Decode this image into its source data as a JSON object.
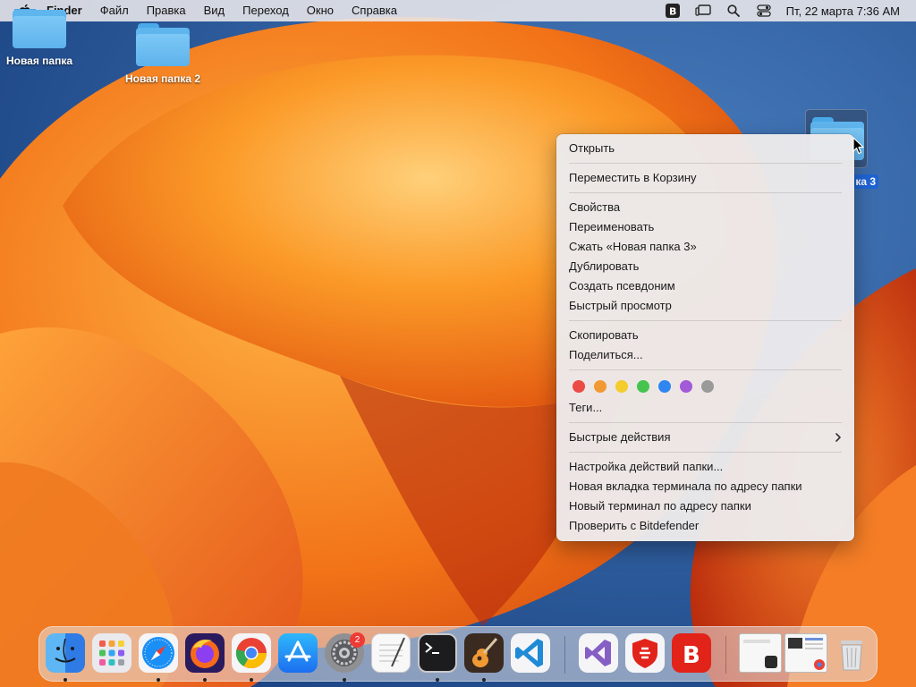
{
  "menubar": {
    "app_name": "Finder",
    "items": [
      "Файл",
      "Правка",
      "Вид",
      "Переход",
      "Окно",
      "Справка"
    ],
    "clock": "Пт, 22 марта  7:36 AM"
  },
  "desktop": {
    "folders": [
      {
        "label": "Новая папка"
      },
      {
        "label": "Новая папка 2"
      },
      {
        "label": "ка 3"
      }
    ]
  },
  "context_menu": {
    "open": "Открыть",
    "trash": "Переместить в Корзину",
    "properties": "Свойства",
    "rename": "Переименовать",
    "compress": "Сжать «Новая папка 3»",
    "duplicate": "Дублировать",
    "alias": "Создать псевдоним",
    "quick_look": "Быстрый просмотр",
    "copy": "Скопировать",
    "share": "Поделиться...",
    "tags": "Теги...",
    "quick_actions": "Быстрые действия",
    "folder_actions": "Настройка действий папки...",
    "new_terminal_tab": "Новая вкладка терминала по адресу папки",
    "new_terminal": "Новый терминал по адресу папки",
    "bitdefender": "Проверить с Bitdefender",
    "tag_colors": [
      "#ec4b45",
      "#f19a34",
      "#f4cd2c",
      "#47c44f",
      "#2f86f0",
      "#a35ad8",
      "#9a9a9a"
    ]
  },
  "dock": {
    "apps": [
      {
        "icon": "finder-icon"
      },
      {
        "icon": "launchpad-icon"
      },
      {
        "icon": "safari-icon"
      },
      {
        "icon": "firefox-icon"
      },
      {
        "icon": "chrome-icon"
      },
      {
        "icon": "app-store-icon"
      },
      {
        "icon": "system-settings-icon"
      },
      {
        "icon": "textedit-icon"
      },
      {
        "icon": "terminal-icon"
      },
      {
        "icon": "garageband-icon"
      },
      {
        "icon": "vscode-icon"
      },
      {
        "icon": "visual-studio-icon"
      },
      {
        "icon": "bitdefender-shield-icon"
      },
      {
        "icon": "bitdefender-icon"
      },
      {
        "icon": "minimized-window-icon"
      },
      {
        "icon": "minimized-chrome-window-icon"
      },
      {
        "icon": "trash-icon"
      }
    ],
    "settings_badge": "2"
  },
  "colors": {
    "accent": "#1f64d6",
    "wallpaper_orange": "#f58a1f",
    "wallpaper_blue": "#1f4f92"
  }
}
